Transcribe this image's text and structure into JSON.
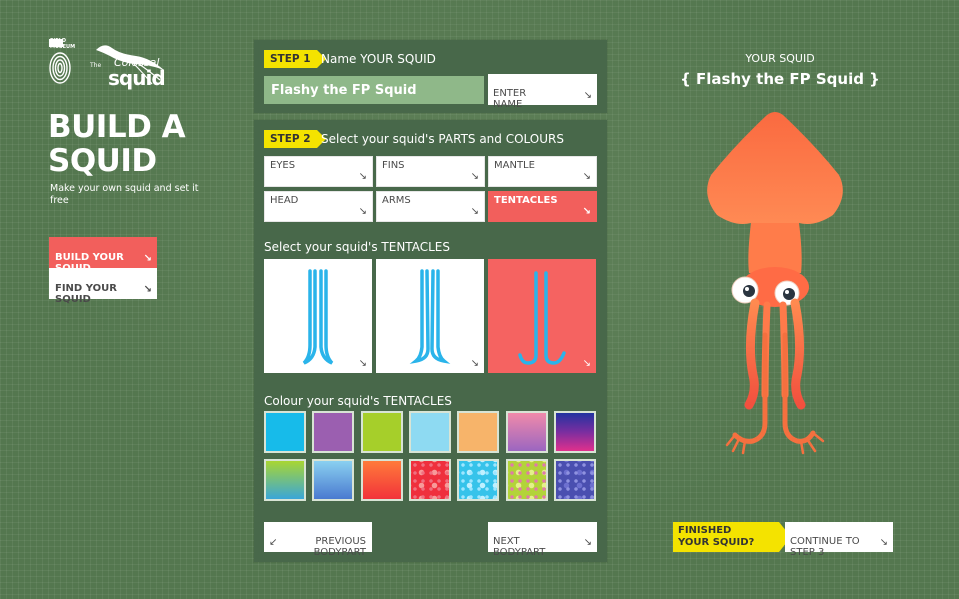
{
  "brand": {
    "museum_logo_text": "FIELD MUSEUM",
    "colossal_small_text": "The",
    "colossal_word": "Colossal",
    "squid_word": "squid"
  },
  "page": {
    "title": "BUILD A\nSQUID",
    "subtitle": "Make your own squid and set it free"
  },
  "nav": {
    "build": "BUILD YOUR\nSQUID",
    "find": "FIND YOUR\nSQUID"
  },
  "step1": {
    "badge": "STEP 1",
    "title": "Name YOUR SQUID",
    "name_value": "Flashy the FP Squid",
    "enter_button": "ENTER\nNAME"
  },
  "step2": {
    "badge": "STEP 2",
    "title": "Select your squid's PARTS and COLOURS",
    "parts": [
      {
        "label": "EYES",
        "selected": false
      },
      {
        "label": "FINS",
        "selected": false
      },
      {
        "label": "MANTLE",
        "selected": false
      },
      {
        "label": "HEAD",
        "selected": false
      },
      {
        "label": "ARMS",
        "selected": false
      },
      {
        "label": "TENTACLES",
        "selected": true
      }
    ],
    "select_label": "Select your squid's TENTACLES",
    "colour_label": "Colour your squid's TENTACLES",
    "selected_tentacle_option": 3,
    "swatches": [
      "solid-blue",
      "solid-purple",
      "solid-lime",
      "solid-light-blue",
      "solid-peach",
      "gradient-pink-purple",
      "gradient-navy-magenta",
      "gradient-blue-green",
      "gradient-sky-blue",
      "gradient-orange-red",
      "spotted-red",
      "spotted-cyan",
      "spotted-lime",
      "spotted-indigo"
    ],
    "previous_button": "PREVIOUS\nBODYPART",
    "next_button": "NEXT\nBODYPART"
  },
  "preview": {
    "label": "YOUR SQUID",
    "name_display": "{ Flashy the FP Squid }"
  },
  "footer": {
    "finished": "FINISHED\nYOUR SQUID?",
    "continue": "CONTINUE TO\nSTEP 3"
  },
  "colors": {
    "background": "#54774f",
    "panel": "#48684a",
    "accent_yellow": "#f4e300",
    "accent_red": "#f25f5c",
    "tentacle_blue": "#2ab4ea",
    "squid_orange": "#f96a3e"
  }
}
